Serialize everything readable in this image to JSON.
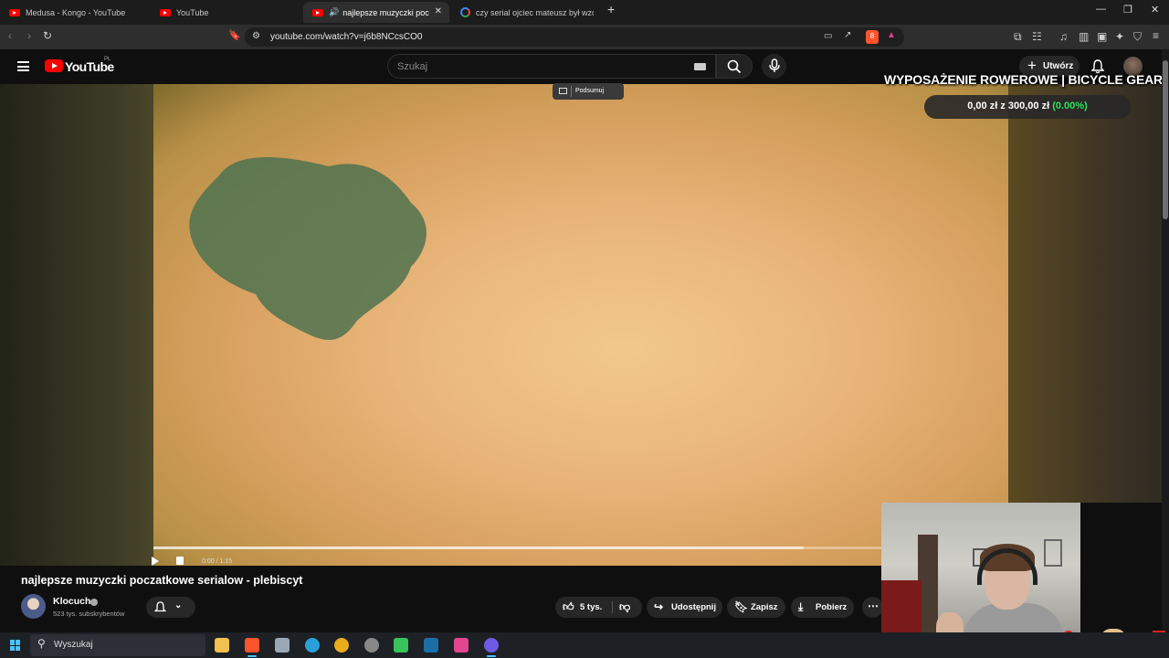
{
  "browser": {
    "tabs": [
      {
        "label": "Medusa - Kongo - YouTube",
        "icon": "youtube-icon"
      },
      {
        "label": "YouTube",
        "icon": "youtube-icon"
      },
      {
        "label": "najlepsze muzyczki poczatkowe serialow",
        "icon": "youtube-icon",
        "active": true
      },
      {
        "label": "czy serial ojciec mateusz był wzorowa",
        "icon": "google-icon"
      }
    ],
    "url": "youtube.com/watch?v=j6b8NCcsCO0",
    "shields_count": "8"
  },
  "youtube": {
    "logo_text": "YouTube",
    "country": "PL",
    "search_placeholder": "Szukaj",
    "create_label": "Utwórz"
  },
  "video": {
    "summary_label": "Podsumuj",
    "time": "0:00 / 1:15",
    "progress": 0.0,
    "buffered_fraction": 0.89,
    "overlay_title": "WYPOSAŻENIE ROWEROWE | BICYCLE GEAR",
    "goal_current": "0,00 zł",
    "goal_sep": " z ",
    "goal_target": "300,00 zł",
    "goal_percent": "(0.00%)"
  },
  "meta": {
    "title": "najlepsze muzyczki poczatkowe serialow - plebiscyt",
    "channel": "Klocuch",
    "subscribers": "523 tys. subskrybentów",
    "likes": "5 tys.",
    "share": "Udostępnij",
    "save": "Zapisz",
    "download": "Pobierz"
  },
  "taskbar": {
    "search_placeholder": "Wyszukaj",
    "apps": [
      {
        "name": "file-explorer-icon",
        "color": "#f2c14e"
      },
      {
        "name": "brave-icon",
        "color": "#fb542b"
      },
      {
        "name": "store-icon",
        "color": "#9aa8b6"
      },
      {
        "name": "edge-icon",
        "color": "#2aa0d8"
      },
      {
        "name": "chrome-icon",
        "color": "#e9ad1c"
      },
      {
        "name": "app-circle-icon",
        "color": "#888888"
      },
      {
        "name": "play-app-icon",
        "color": "#37c45a"
      },
      {
        "name": "steam-icon",
        "color": "#1b6ea8"
      },
      {
        "name": "app-colorful-icon",
        "color": "#e2468d"
      },
      {
        "name": "discord-icon",
        "color": "#6d5be5"
      }
    ]
  },
  "colors": {
    "accent": "#ff0000",
    "goal_percent": "#2fe35c",
    "taskbar_accent": "#4cc2ff"
  }
}
